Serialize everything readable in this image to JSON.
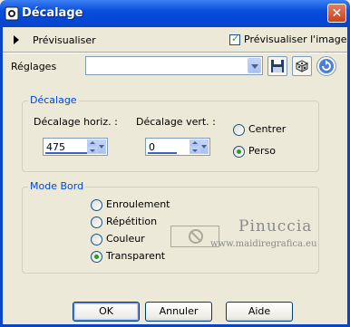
{
  "window": {
    "title": "Décalage",
    "close_label": "✕"
  },
  "preview": {
    "toggle_label": "Prévisualiser",
    "checkbox_label": "Prévisualiser l'image",
    "checked": true
  },
  "settings": {
    "label": "Réglages",
    "value": ""
  },
  "offset_group": {
    "title": "Décalage",
    "horiz_label": "Décalage horiz. :",
    "horiz_value": "475",
    "vert_label": "Décalage vert. :",
    "vert_value": "0",
    "radio_center": "Centrer",
    "radio_custom": "Perso",
    "selected": "Perso"
  },
  "edge_group": {
    "title": "Mode Bord",
    "options": [
      "Enroulement",
      "Répétition",
      "Couleur",
      "Transparent"
    ],
    "selected": "Transparent"
  },
  "watermark": {
    "name": "Pinuccia",
    "url": "www.maidiregrafica.eu"
  },
  "buttons": {
    "ok": "OK",
    "cancel": "Annuler",
    "help": "Aide"
  },
  "colors": {
    "title_bar": "#0a4fdc",
    "dialog_bg": "#ece9d8",
    "group_title": "#0046d5",
    "radio_dot": "#21a121"
  }
}
